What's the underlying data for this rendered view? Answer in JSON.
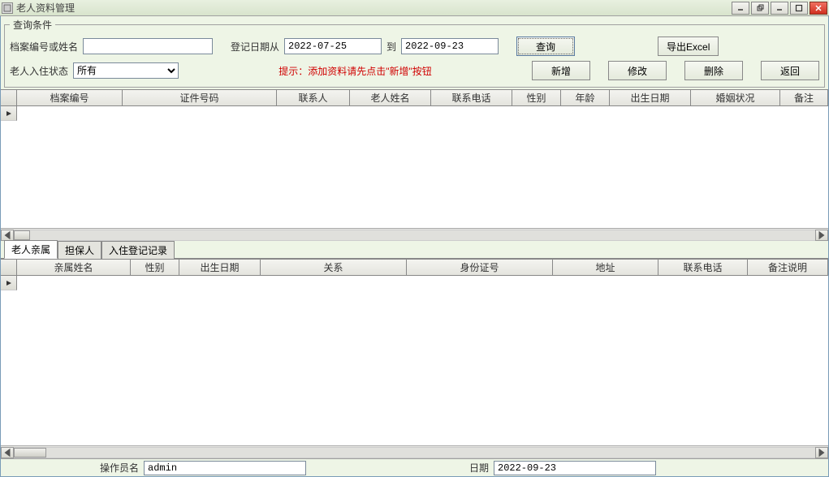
{
  "window_title": "老人资料管理",
  "query": {
    "legend": "查询条件",
    "id_or_name_label": "档案编号或姓名",
    "id_or_name_value": "",
    "date_from_label": "登记日期从",
    "date_from_value": "2022-07-25",
    "date_to_label": "到",
    "date_to_value": "2022-09-23",
    "search_btn": "查询",
    "export_btn": "导出Excel",
    "status_label": "老人入住状态",
    "status_value": "所有",
    "hint": "提示：添加资料请先点击\"新增\"按钮",
    "add_btn": "新增",
    "edit_btn": "修改",
    "delete_btn": "删除",
    "back_btn": "返回"
  },
  "grid1_cols": [
    "档案编号",
    "证件号码",
    "联系人",
    "老人姓名",
    "联系电话",
    "性别",
    "年龄",
    "出生日期",
    "婚姻状况",
    "备注"
  ],
  "tabs": [
    "老人亲属",
    "担保人",
    "入住登记记录"
  ],
  "grid2_cols": [
    "亲属姓名",
    "性别",
    "出生日期",
    "关系",
    "身份证号",
    "地址",
    "联系电话",
    "备注说明"
  ],
  "statusbar": {
    "operator_label": "操作员名",
    "operator_value": "admin",
    "date_label": "日期",
    "date_value": "2022-09-23"
  }
}
